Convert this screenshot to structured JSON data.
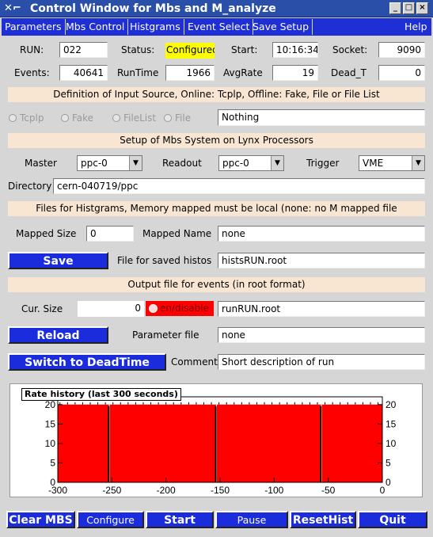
{
  "window": {
    "title": "Control Window for Mbs and M_analyze",
    "controls": [
      "_",
      "□",
      "×"
    ]
  },
  "menubar": [
    "Parameters",
    "Mbs Control",
    "Histgrams",
    "Event Select",
    "Save Setup",
    "Help"
  ],
  "status": {
    "run_label": "RUN:",
    "run_value": "022",
    "status_label": "Status:",
    "status_value": "Configured",
    "start_label": "Start:",
    "start_value": "10:16:34",
    "socket_label": "Socket:",
    "socket_value": "9090",
    "events_label": "Events:",
    "events_value": "40641",
    "runtime_label": "RunTime",
    "runtime_value": "1966",
    "avgrate_label": "AvgRate",
    "avgrate_value": "19",
    "deadt_label": "Dead_T",
    "deadt_value": "0"
  },
  "input_source": {
    "heading": "Definition of Input Source, Online: Tcplp, Offline: Fake, File or File List",
    "options": [
      "Tcplp",
      "Fake",
      "FileList",
      "File"
    ],
    "value": "Nothing"
  },
  "mbs_setup": {
    "heading": "Setup of Mbs System on Lynx Processors",
    "master_label": "Master",
    "master_value": "ppc-0",
    "readout_label": "Readout",
    "readout_value": "ppc-0",
    "trigger_label": "Trigger",
    "trigger_value": "VME",
    "directory_label": "Directory",
    "directory_value": "cern-040719/ppc"
  },
  "histos": {
    "heading": "Files for Histgrams, Memory mapped must be local (none: no M mapped file",
    "mapped_size_label": "Mapped Size",
    "mapped_size_value": "0",
    "mapped_name_label": "Mapped Name",
    "mapped_name_value": "none",
    "save_label": "Save",
    "saved_file_label": "File for saved histos",
    "saved_file_value": "histsRUN.root"
  },
  "output": {
    "heading": "Output file for events (in root format)",
    "cursize_label": "Cur. Size",
    "cursize_value": "0",
    "toggle_label": "en/disable",
    "file_value": "runRUN.root",
    "reload_label": "Reload",
    "param_label": "Parameter file",
    "param_value": "none",
    "deadtime_label": "Switch to DeadTime",
    "comment_label": "Comment",
    "comment_value": "Short description of run"
  },
  "colors": {
    "menu_blue": "#1e2fd6",
    "button_blue": "#1a2cdc",
    "bar_red": "#ff0000",
    "section_bg": "#f8e6d2",
    "status_yellow": "#ffff00"
  },
  "chart_data": {
    "type": "bar",
    "title": "Rate history (last 300 seconds)",
    "xlabel": "",
    "ylabel": "",
    "xlim": [
      -300,
      0
    ],
    "ylim": [
      0,
      22
    ],
    "x_ticks": [
      -300,
      -250,
      -200,
      -150,
      -100,
      -50,
      0
    ],
    "y_ticks": [
      0,
      5,
      10,
      15,
      20
    ],
    "grid": false,
    "bin_width_s": 1,
    "baseline_rate": 20,
    "gaps_at": [
      -253,
      -154,
      -57
    ],
    "color": "#ff0000"
  },
  "bottom_buttons": [
    "Clear MBS",
    "Configure",
    "Start",
    "Pause",
    "ResetHist",
    "Quit"
  ]
}
